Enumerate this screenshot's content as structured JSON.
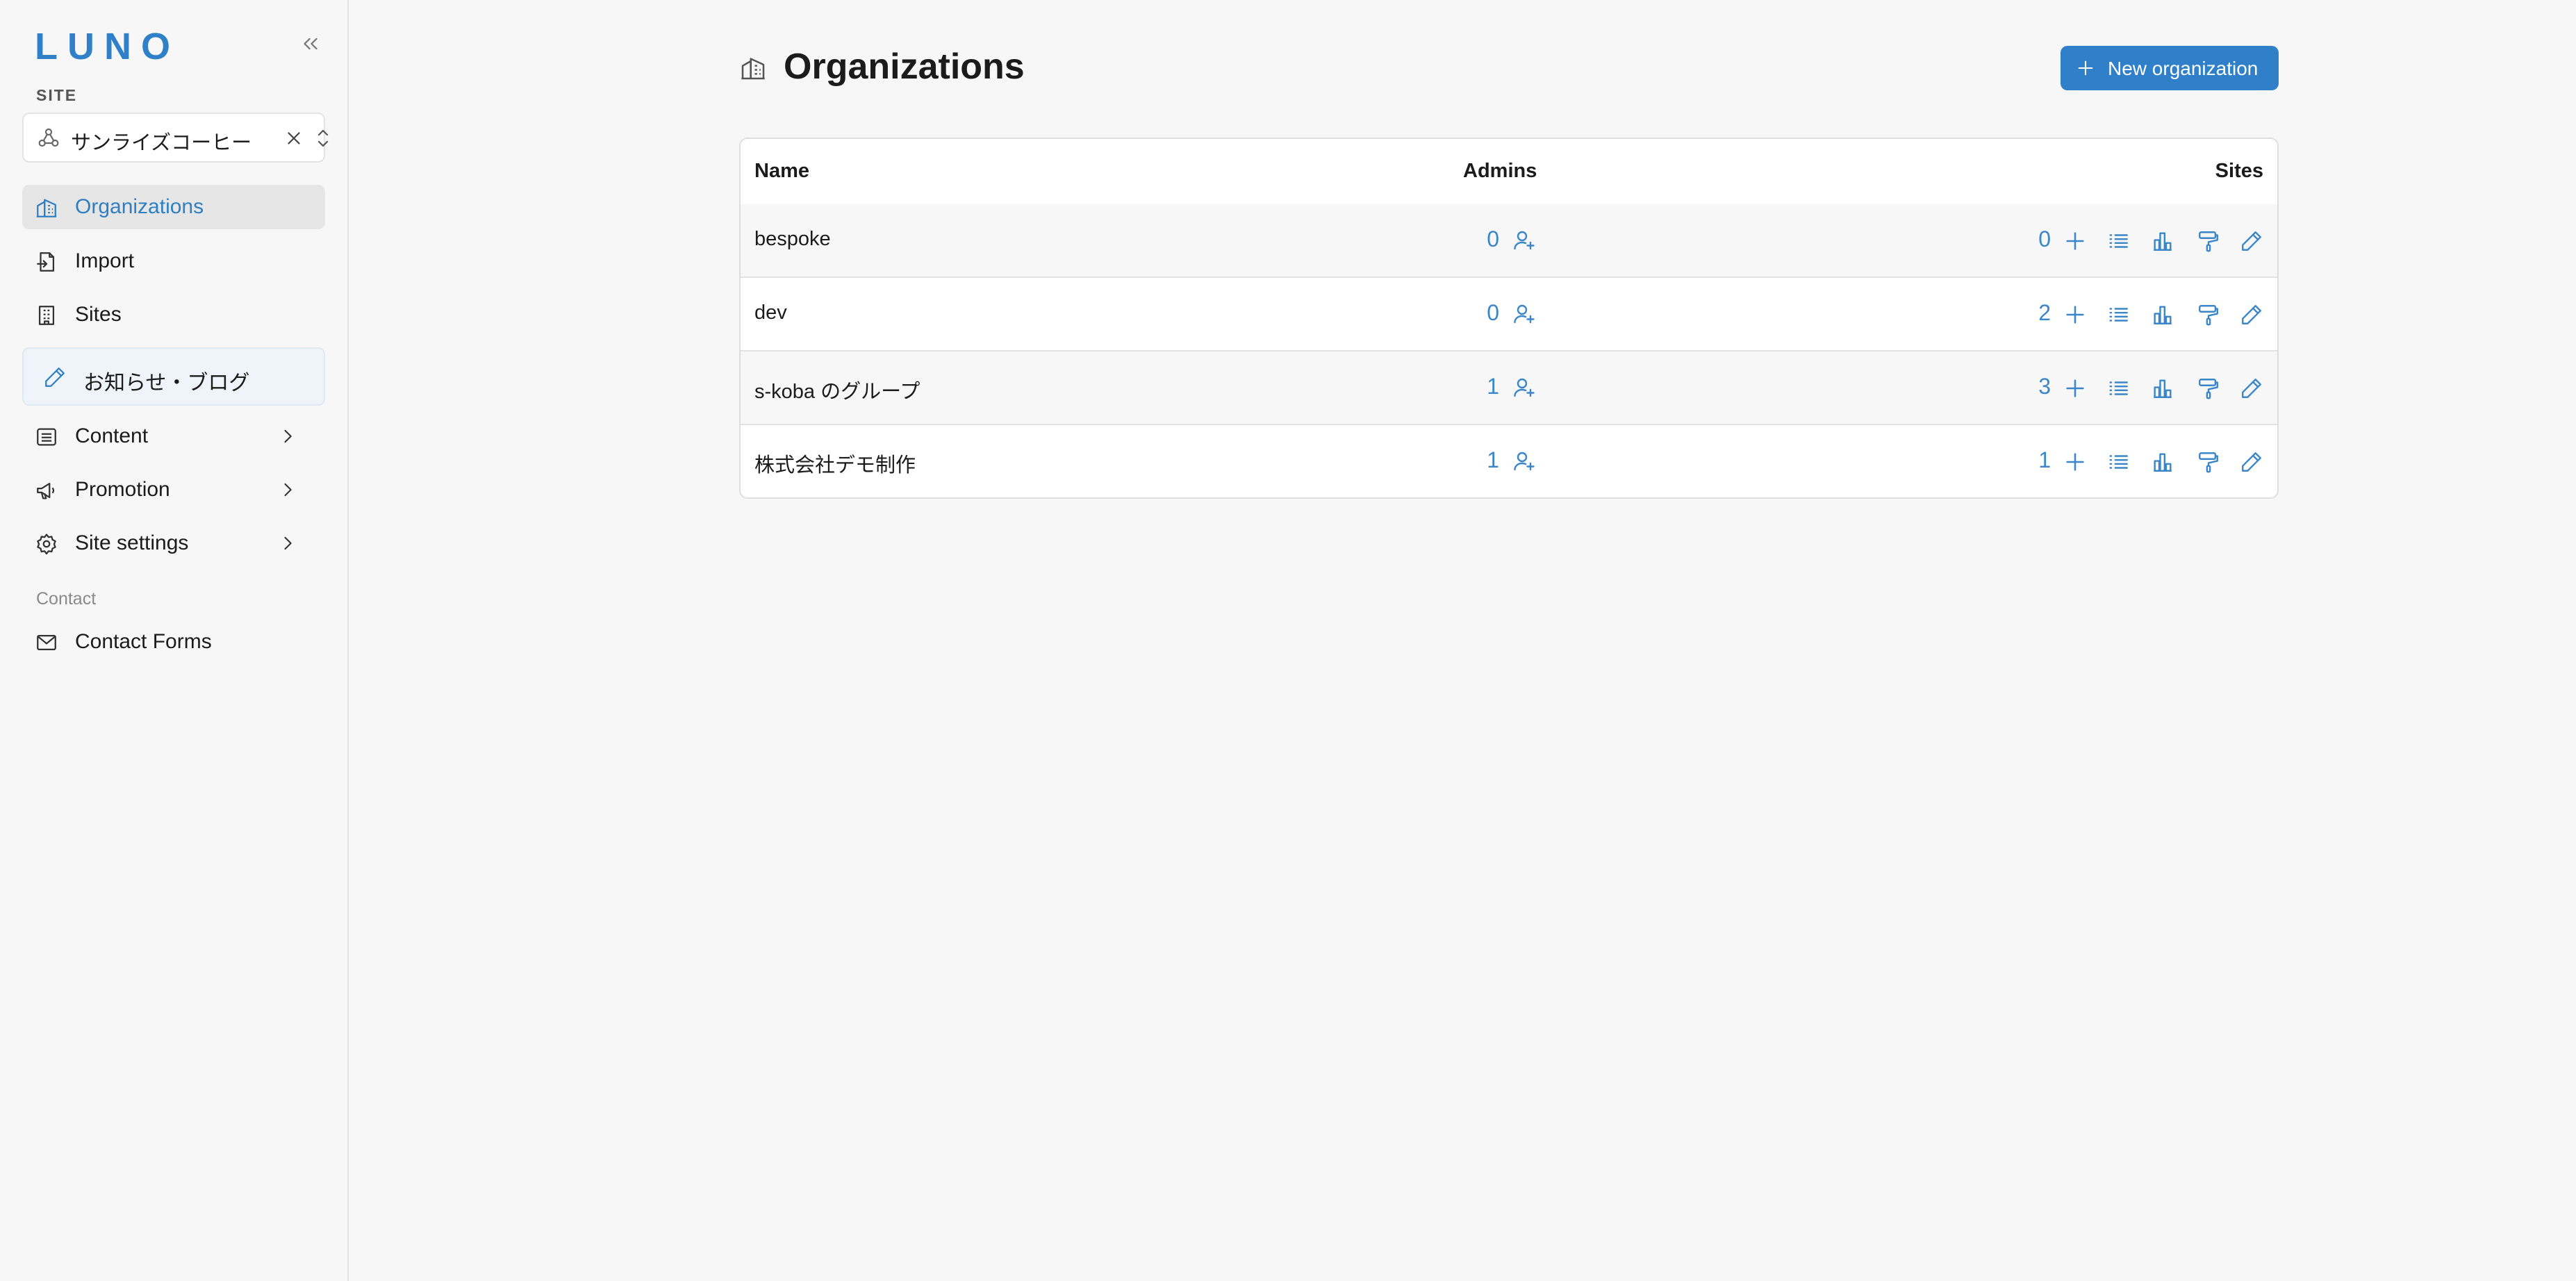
{
  "app": {
    "logo": "LUNO",
    "accent_color": "#2f80c8"
  },
  "sidebar": {
    "collapse_icon": "chevrons-left-icon",
    "site_label": "SITE",
    "site_select": {
      "value": "サンライズコーヒー",
      "icon": "site-network-icon",
      "clear_icon": "close-icon",
      "toggle_icon": "chevron-updown-icon"
    },
    "items": [
      {
        "label": "Organizations",
        "icon": "organization-icon",
        "active": true
      },
      {
        "label": "Import",
        "icon": "file-import-icon"
      },
      {
        "label": "Sites",
        "icon": "building-icon"
      },
      {
        "label": "お知らせ・ブログ",
        "icon": "pencil-icon",
        "highlighted": true
      },
      {
        "label": "Content",
        "icon": "list-box-icon",
        "has_submenu": true
      },
      {
        "label": "Promotion",
        "icon": "megaphone-icon",
        "has_submenu": true
      },
      {
        "label": "Site settings",
        "icon": "gear-icon",
        "has_submenu": true
      }
    ],
    "contact_section": {
      "label": "Contact",
      "items": [
        {
          "label": "Contact Forms",
          "icon": "mail-icon"
        }
      ]
    }
  },
  "main": {
    "title": "Organizations",
    "title_icon": "organization-icon",
    "new_button": {
      "label": "New organization",
      "icon": "plus-icon"
    },
    "table": {
      "columns": {
        "name": "Name",
        "admins": "Admins",
        "sites": "Sites"
      },
      "rows": [
        {
          "name": "bespoke",
          "admins": "0",
          "sites": "0"
        },
        {
          "name": "dev",
          "admins": "0",
          "sites": "2"
        },
        {
          "name": "s-koba のグループ",
          "admins": "1",
          "sites": "3"
        },
        {
          "name": "株式会社デモ制作",
          "admins": "1",
          "sites": "1"
        }
      ],
      "row_actions": [
        "add-admin-icon",
        "plus-icon",
        "list-icon",
        "bar-chart-icon",
        "paint-roller-icon",
        "pencil-icon"
      ]
    }
  }
}
